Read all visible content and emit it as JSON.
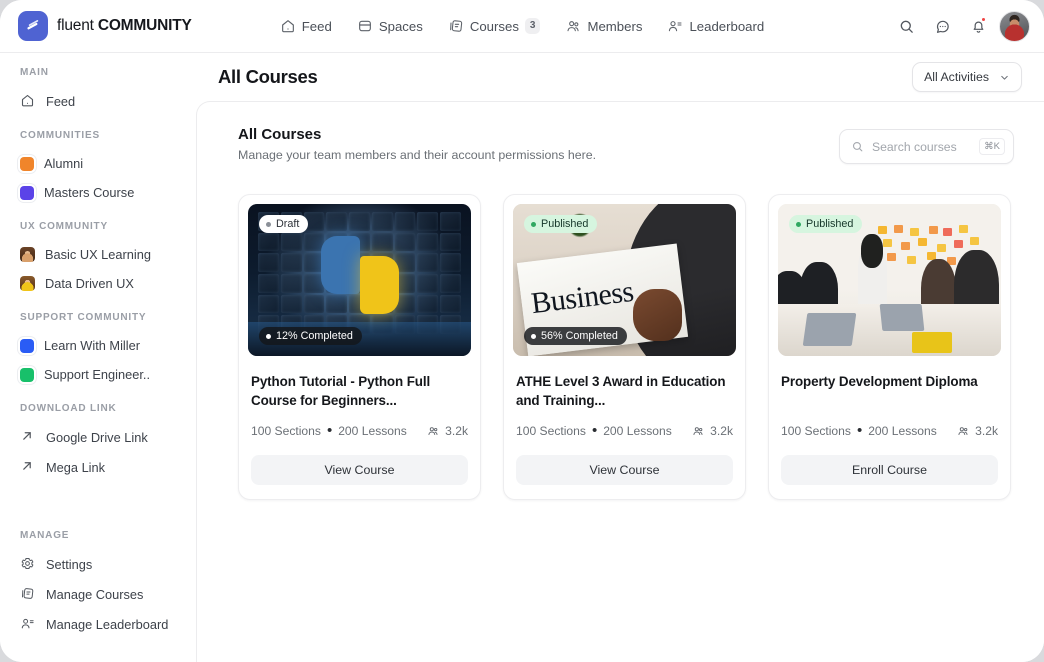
{
  "brand": {
    "light_text": "fluent ",
    "bold_text": "COMMUNITY"
  },
  "topnav": {
    "items": [
      {
        "label": "Feed",
        "icon": "home-icon",
        "badge": ""
      },
      {
        "label": "Spaces",
        "icon": "spaces-icon",
        "badge": ""
      },
      {
        "label": "Courses",
        "icon": "courses-icon",
        "badge": "3"
      },
      {
        "label": "Members",
        "icon": "members-icon",
        "badge": ""
      },
      {
        "label": "Leaderboard",
        "icon": "leaderboard-icon",
        "badge": ""
      }
    ],
    "actions": [
      {
        "name": "search-icon"
      },
      {
        "name": "messages-icon"
      },
      {
        "name": "notifications-icon"
      }
    ]
  },
  "sidebar": {
    "sections": [
      {
        "label": "MAIN",
        "items": [
          {
            "label": "Feed",
            "icon": "home-icon"
          }
        ]
      },
      {
        "label": "COMMUNITIES",
        "items": [
          {
            "label": "Alumni",
            "icon": "color-swatch",
            "color": "#f0852b"
          },
          {
            "label": "Masters Course",
            "icon": "color-swatch",
            "color": "#5b43e8"
          }
        ]
      },
      {
        "label": "UX COMMUNITY",
        "items": [
          {
            "label": "Basic UX Learning",
            "icon": "avatar-thumb"
          },
          {
            "label": "Data Driven UX",
            "icon": "avatar-thumb"
          }
        ]
      },
      {
        "label": "SUPPORT COMMUNITY",
        "items": [
          {
            "label": "Learn With Miller",
            "icon": "color-swatch",
            "color": "#2a5cf5"
          },
          {
            "label": "Support Engineer..",
            "icon": "color-swatch",
            "color": "#18c06a"
          }
        ]
      },
      {
        "label": "DOWNLOAD LINK",
        "items": [
          {
            "label": "Google Drive Link",
            "icon": "external-link-icon"
          },
          {
            "label": "Mega Link",
            "icon": "external-link-icon"
          }
        ]
      },
      {
        "label": "MANAGE",
        "items": [
          {
            "label": "Settings",
            "icon": "gear-icon"
          },
          {
            "label": "Manage Courses",
            "icon": "courses-icon"
          },
          {
            "label": "Manage Leaderboard",
            "icon": "leaderboard-icon"
          }
        ]
      }
    ]
  },
  "header": {
    "title": "All Courses",
    "filter_label": "All Activities"
  },
  "panel": {
    "title": "All Courses",
    "subtitle": "Manage your team members and their account permissions here.",
    "search_placeholder": "Search courses",
    "search_value": "",
    "search_shortcut": "⌘K"
  },
  "courses": [
    {
      "status": "Draft",
      "status_type": "draft",
      "progress": "12% Completed",
      "title": "Python Tutorial - Python Full Course for Beginners...",
      "sections": "100 Sections",
      "lessons": "200 Lessons",
      "learners": "3.2k",
      "action": "View Course",
      "art": "python"
    },
    {
      "status": "Published",
      "status_type": "published",
      "progress": "56% Completed",
      "title": "ATHE Level 3 Award in Education and Training...",
      "sections": "100 Sections",
      "lessons": "200 Lessons",
      "learners": "3.2k",
      "action": "View Course",
      "art": "business"
    },
    {
      "status": "Published",
      "status_type": "published",
      "progress": "",
      "title": "Property Development Diploma",
      "sections": "100 Sections",
      "lessons": "200 Lessons",
      "learners": "3.2k",
      "action": "Enroll Course",
      "art": "workshop"
    }
  ],
  "colors": {
    "brand": "#4f63d2",
    "published_badge_bg": "#d6f5df",
    "published_dot": "#2fa861",
    "notification_dot": "#ef4444"
  }
}
